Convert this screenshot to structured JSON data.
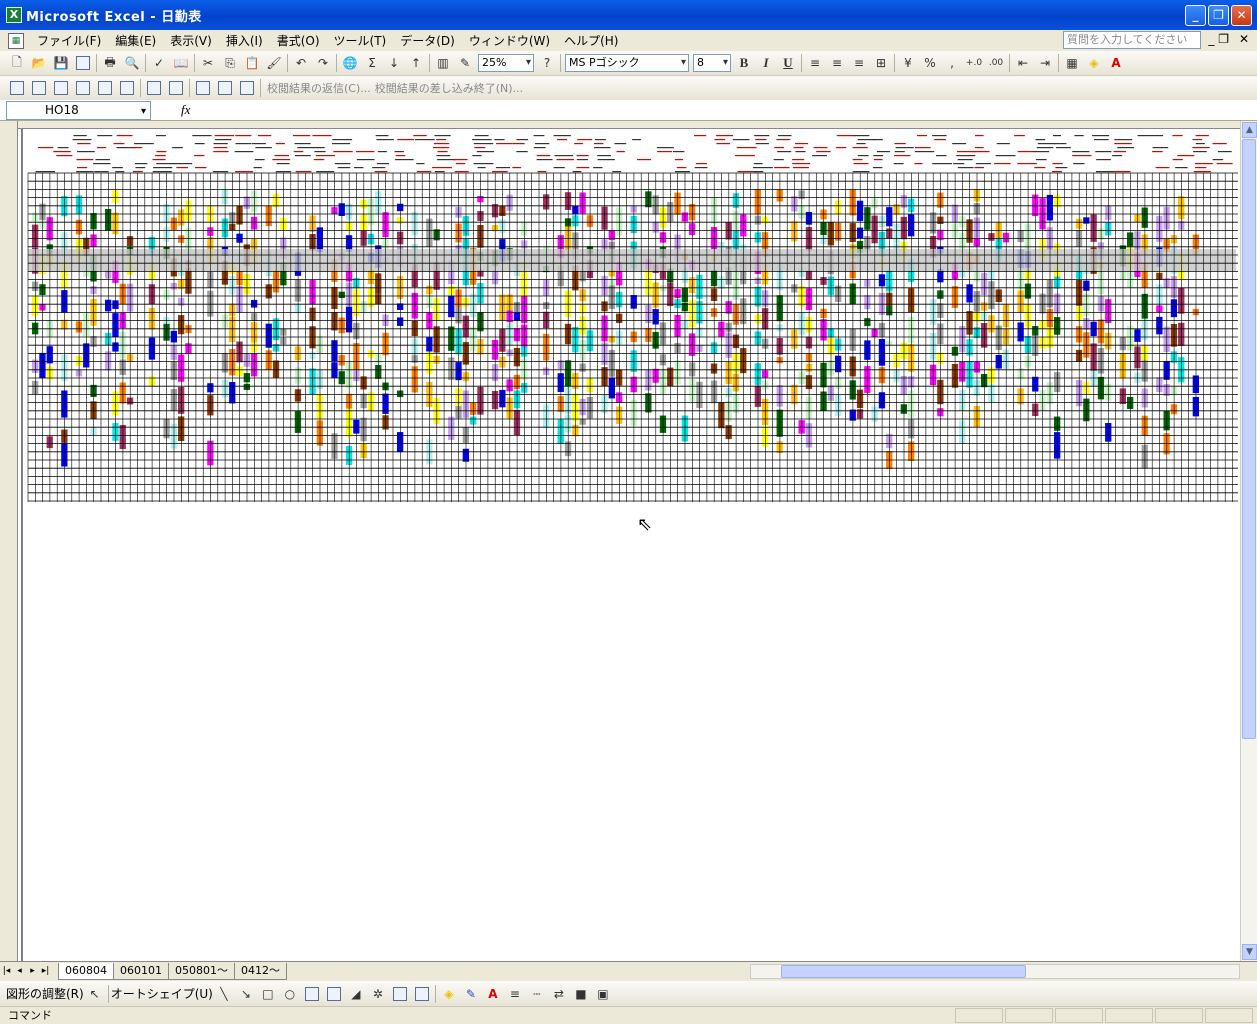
{
  "window": {
    "title": "Microsoft Excel - 日勤表",
    "minimize": "_",
    "restore": "❐",
    "close": "✕"
  },
  "menu": {
    "items": [
      "ファイル(F)",
      "編集(E)",
      "表示(V)",
      "挿入(I)",
      "書式(O)",
      "ツール(T)",
      "データ(D)",
      "ウィンドウ(W)",
      "ヘルプ(H)"
    ],
    "help_placeholder": "質問を入力してください"
  },
  "toolbar": {
    "zoom": "25%",
    "font_name": "MS Pゴシック",
    "font_size": "8",
    "bold": "B",
    "italic": "I",
    "underline": "U",
    "percent": "%",
    "comma": ",",
    "dec_inc": "+.0",
    "dec_dec": ".00"
  },
  "review_toolbar": {
    "reply": "校閲結果の返信(C)...",
    "end_review": "校閲結果の差し込み終了(N)..."
  },
  "formula": {
    "cell_ref": "HO18",
    "fx": "fx"
  },
  "sheet_tabs": [
    "060804",
    "060101",
    "050801～",
    "0412～"
  ],
  "drawing": {
    "adjust": "図形の調整(R)",
    "autoshape": "オートシェイプ(U)"
  },
  "status": {
    "mode": "コマンド"
  },
  "colors": [
    "#ffff00",
    "#00e5e5",
    "#c8a0f0",
    "#ff00ff",
    "#ff8000",
    "#006600",
    "#8b3a00",
    "#a0a0a0",
    "#ffc000",
    "#0000ff",
    "#c8f5c8",
    "#b0f0f0",
    "#a03060"
  ]
}
